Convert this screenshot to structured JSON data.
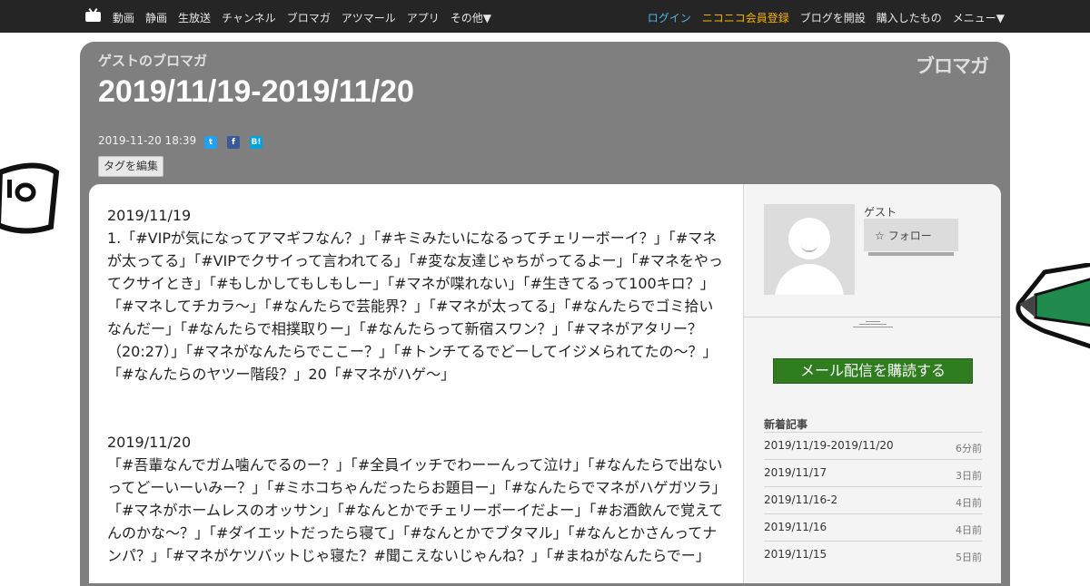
{
  "topbar": {
    "logo_icon": "niconico-tv-icon",
    "nav_left": [
      "動画",
      "静画",
      "生放送",
      "チャンネル",
      "ブロマガ",
      "アツマール",
      "アプリ",
      "その他▼"
    ],
    "login": "ログイン",
    "register": "ニコニコ会員登録",
    "open_blog": "ブログを開設",
    "purchased": "購入したもの",
    "menu": "メニュー▼",
    "colors": {
      "bg": "#252525",
      "login": "#4fb7e6",
      "register": "#f5b400"
    }
  },
  "header": {
    "blog_name": "ゲストのブロマガ",
    "title": "2019/11/19-2019/11/20",
    "brand": "ブロマガ",
    "post_date": "2019-11-20 18:39",
    "share_icons": [
      "twitter-icon",
      "facebook-icon",
      "hatena-bookmark-icon"
    ],
    "share_glyphs": {
      "twitter": "t",
      "facebook": "f",
      "hatena": "B!"
    },
    "tag_edit": "タグを編集"
  },
  "article": {
    "day1_heading": "2019/11/19",
    "day1_text": "1.「#VIPが気になってアマギフなん？」「#キミみたいになるってチェリーボーイ？」「#マネが太ってる」「#VIPでクサイって言われてる」「#変な友達じゃちがってるよー」「#マネをやってクサイとき」「#もしかしてもしもしー」「#マネが喋れない」「#生きてるって100キロ？」「#マネしてチカラ〜」「#なんたらで芸能界？」「#マネが太ってる」「#なんたらでゴミ拾いなんだー」「#なんたらで相撲取りー」「#なんたらって新宿スワン？」「#マネがアタリー？（20:27）」「#マネがなんたらでここー？」「#トンチてるでどーしてイジメられてたの〜？」「#なんたらのヤツー階段？」20「#マネがハゲ〜」",
    "day2_heading": "2019/11/20",
    "day2_text": "「#吾輩なんでガム噛んでるのー？」「#全員イッチでわーーんって泣け」「#なんたらで出ないってどーいーいみー？」「#ミホコちゃんだったらお題目ー」「#なんたらでマネがハゲガツラ」「#マネがホームレスのオッサン」「#なんとかでチェリーボーイだよー」「#お酒飲んで覚えてんのかな〜？」「#ダイエットだったら寝て」「#なんとかでブタマル」「#なんとかさんってナンパ？」「#マネがケツバットじゃ寝た？#聞こえないじゃんね？」「#まねがなんたらでー」"
  },
  "sidebar": {
    "user_name": "ゲスト",
    "follow_label": "フォロー",
    "follow_icon": "star-outline-icon",
    "subscribe_label": "メール配信を購読する",
    "subscribe_color": "#2f7d1f",
    "new_posts_title": "新着記事",
    "new_posts": [
      {
        "title": "2019/11/19-2019/11/20",
        "age": "6分前"
      },
      {
        "title": "2019/11/17",
        "age": "3日前"
      },
      {
        "title": "2019/11/16-2",
        "age": "4日前"
      },
      {
        "title": "2019/11/16",
        "age": "4日前"
      },
      {
        "title": "2019/11/15",
        "age": "5日前"
      }
    ]
  }
}
